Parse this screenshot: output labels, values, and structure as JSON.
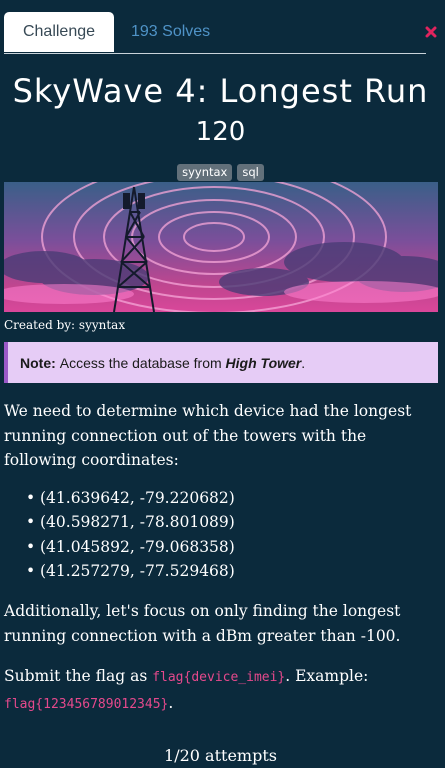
{
  "tabs": {
    "challenge": "Challenge",
    "solves": "193 Solves"
  },
  "challenge": {
    "title": "SkyWave 4: Longest Run",
    "value": "120",
    "tags": [
      "syyntax",
      "sql"
    ],
    "created_by": "Created by: syyntax"
  },
  "note": {
    "label": "Note:",
    "text_before": "Access the database from ",
    "emphasis": "High Tower",
    "text_after": "."
  },
  "description": {
    "intro": "We need to determine which device had the longest running connection out of the towers with the following coordinates:",
    "coordinates": [
      "(41.639642, -79.220682)",
      "(40.598271, -78.801089)",
      "(41.045892, -79.068358)",
      "(41.257279, -77.529468)"
    ],
    "additional": "Additionally, let's focus on only finding the longest running connection with a dBm greater than -100.",
    "submit_prefix": "Submit the flag as ",
    "flag_format": "flag{device_imei}",
    "example_label": ". Example:",
    "example_flag": "flag{123456789012345}",
    "example_suffix": "."
  },
  "attempts": "1/20 attempts",
  "colors": {
    "background": "#0b2a3c",
    "link": "#4f93c7",
    "note_bg": "#e6ccf6",
    "note_border": "#9b59c8",
    "code": "#e5498c",
    "close_icon": "#e0245e"
  }
}
